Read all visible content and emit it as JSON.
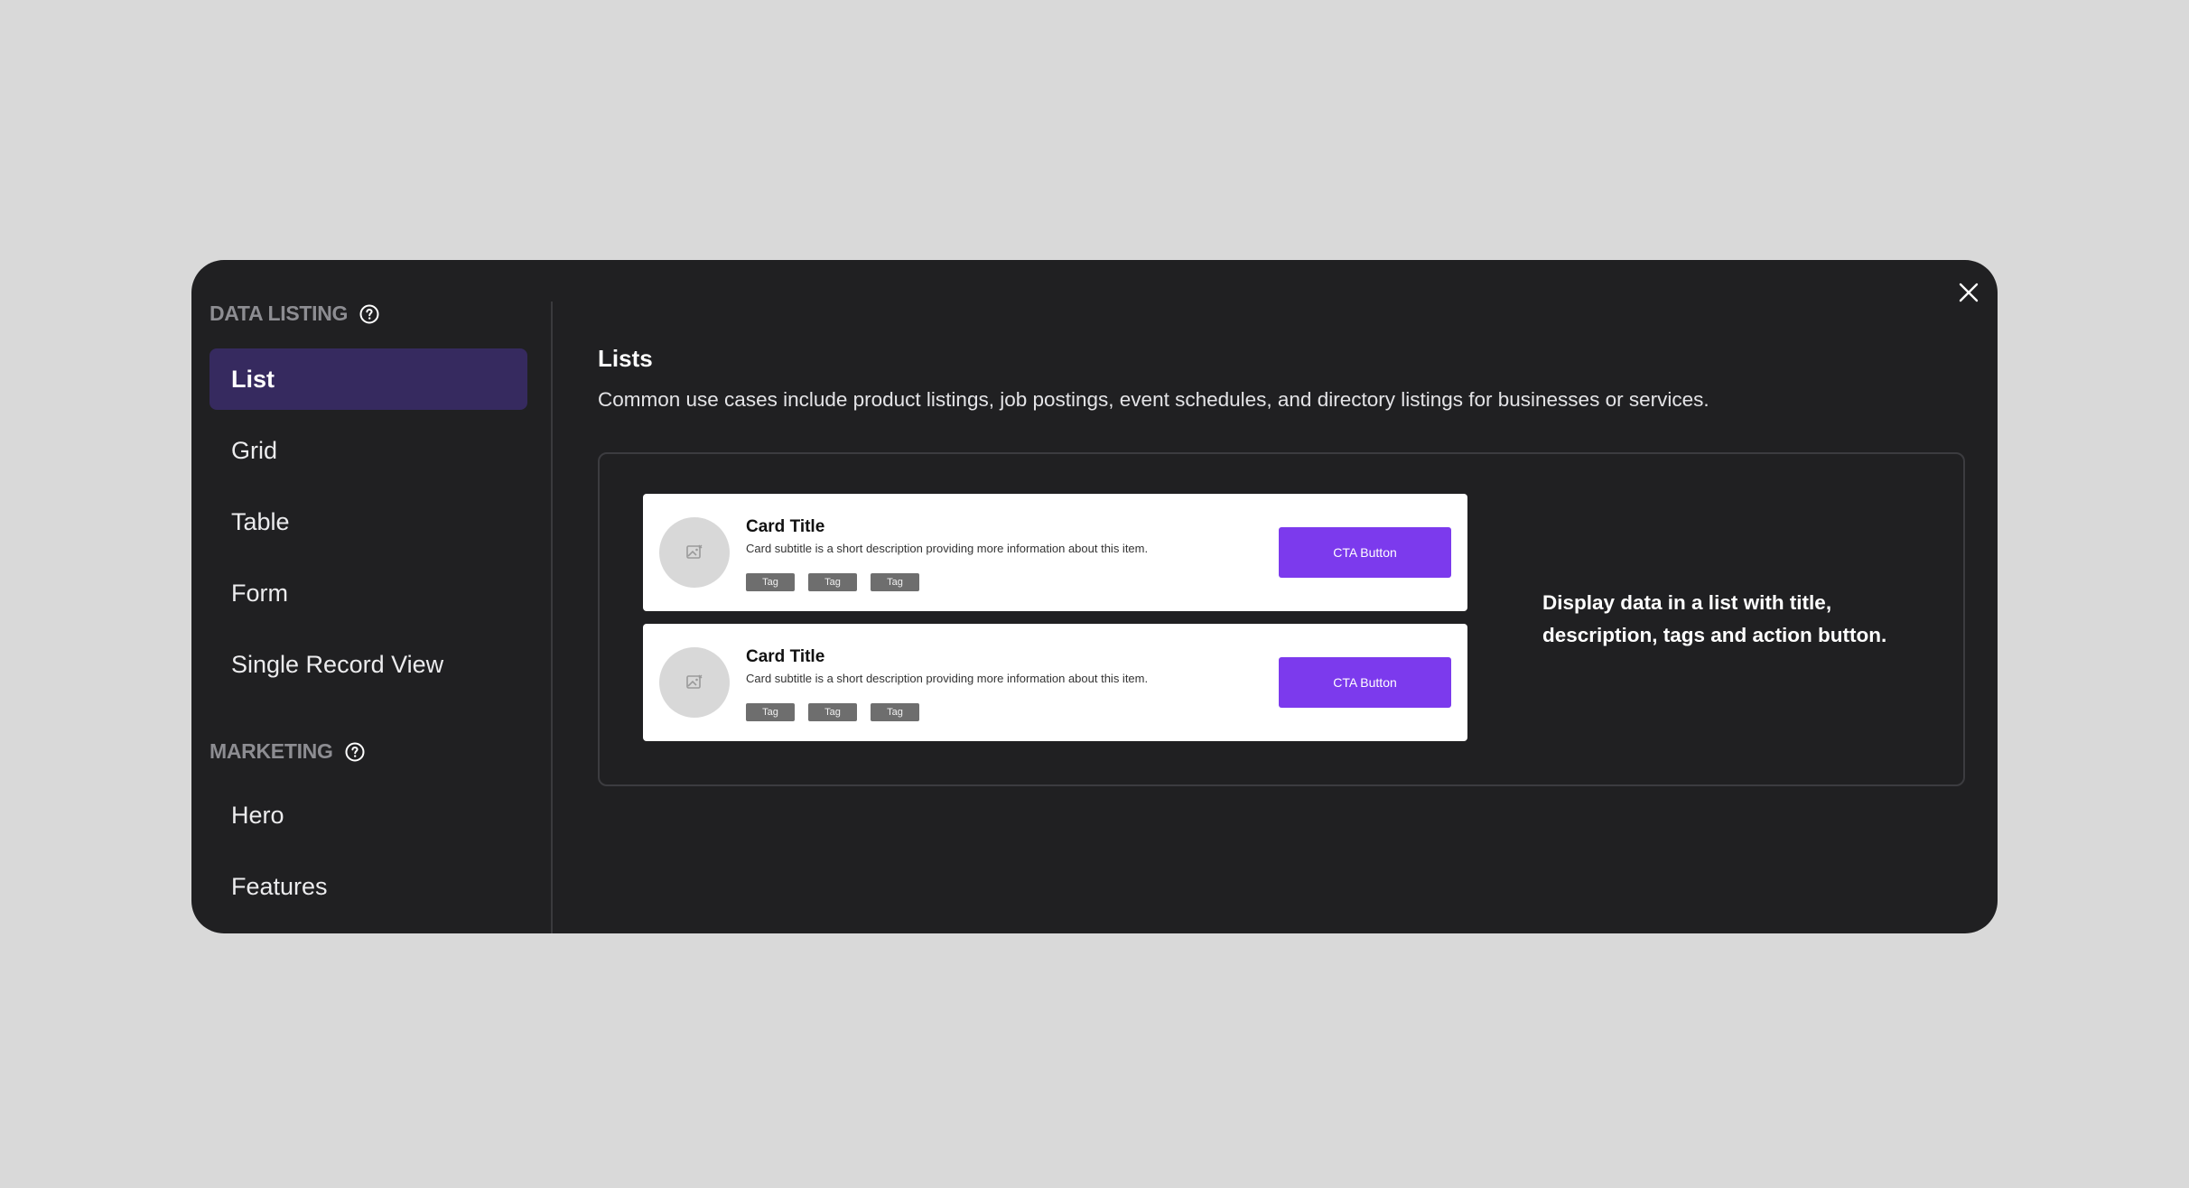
{
  "sidebar": {
    "sections": [
      {
        "title": "DATA LISTING",
        "help_icon": "help-circle-icon",
        "items": [
          {
            "label": "List",
            "active": true
          },
          {
            "label": "Grid"
          },
          {
            "label": "Table"
          },
          {
            "label": "Form"
          },
          {
            "label": "Single Record View"
          }
        ]
      },
      {
        "title": "MARKETING",
        "help_icon": "help-circle-icon",
        "items": [
          {
            "label": "Hero"
          },
          {
            "label": "Features"
          }
        ]
      }
    ]
  },
  "content": {
    "title": "Lists",
    "description": "Common use cases include product listings, job postings, event schedules, and directory listings for businesses or services.",
    "preview": {
      "cards": [
        {
          "title": "Card Title",
          "subtitle": "Card subtitle is a short description providing more information about this item.",
          "tags": [
            "Tag",
            "Tag",
            "Tag"
          ],
          "cta": "CTA Button",
          "avatar_icon": "image-placeholder-icon"
        },
        {
          "title": "Card Title",
          "subtitle": "Card subtitle is a short description providing more information about this item.",
          "tags": [
            "Tag",
            "Tag",
            "Tag"
          ],
          "cta": "CTA Button",
          "avatar_icon": "image-placeholder-icon"
        }
      ],
      "caption": "Display data in a list with title, description, tags and action button."
    }
  },
  "close_icon": "close-icon",
  "colors": {
    "backdrop": "#d9d9d9",
    "modal": "#202022",
    "active_item": "#362a5f",
    "cta": "#7c3aed"
  }
}
